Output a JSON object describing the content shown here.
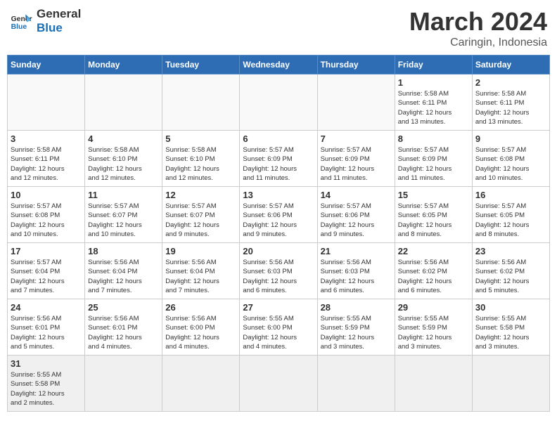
{
  "header": {
    "logo_general": "General",
    "logo_blue": "Blue",
    "title": "March 2024",
    "subtitle": "Caringin, Indonesia"
  },
  "weekdays": [
    "Sunday",
    "Monday",
    "Tuesday",
    "Wednesday",
    "Thursday",
    "Friday",
    "Saturday"
  ],
  "weeks": [
    [
      {
        "day": "",
        "info": ""
      },
      {
        "day": "",
        "info": ""
      },
      {
        "day": "",
        "info": ""
      },
      {
        "day": "",
        "info": ""
      },
      {
        "day": "",
        "info": ""
      },
      {
        "day": "1",
        "info": "Sunrise: 5:58 AM\nSunset: 6:11 PM\nDaylight: 12 hours\nand 13 minutes."
      },
      {
        "day": "2",
        "info": "Sunrise: 5:58 AM\nSunset: 6:11 PM\nDaylight: 12 hours\nand 13 minutes."
      }
    ],
    [
      {
        "day": "3",
        "info": "Sunrise: 5:58 AM\nSunset: 6:11 PM\nDaylight: 12 hours\nand 12 minutes."
      },
      {
        "day": "4",
        "info": "Sunrise: 5:58 AM\nSunset: 6:10 PM\nDaylight: 12 hours\nand 12 minutes."
      },
      {
        "day": "5",
        "info": "Sunrise: 5:58 AM\nSunset: 6:10 PM\nDaylight: 12 hours\nand 12 minutes."
      },
      {
        "day": "6",
        "info": "Sunrise: 5:57 AM\nSunset: 6:09 PM\nDaylight: 12 hours\nand 11 minutes."
      },
      {
        "day": "7",
        "info": "Sunrise: 5:57 AM\nSunset: 6:09 PM\nDaylight: 12 hours\nand 11 minutes."
      },
      {
        "day": "8",
        "info": "Sunrise: 5:57 AM\nSunset: 6:09 PM\nDaylight: 12 hours\nand 11 minutes."
      },
      {
        "day": "9",
        "info": "Sunrise: 5:57 AM\nSunset: 6:08 PM\nDaylight: 12 hours\nand 10 minutes."
      }
    ],
    [
      {
        "day": "10",
        "info": "Sunrise: 5:57 AM\nSunset: 6:08 PM\nDaylight: 12 hours\nand 10 minutes."
      },
      {
        "day": "11",
        "info": "Sunrise: 5:57 AM\nSunset: 6:07 PM\nDaylight: 12 hours\nand 10 minutes."
      },
      {
        "day": "12",
        "info": "Sunrise: 5:57 AM\nSunset: 6:07 PM\nDaylight: 12 hours\nand 9 minutes."
      },
      {
        "day": "13",
        "info": "Sunrise: 5:57 AM\nSunset: 6:06 PM\nDaylight: 12 hours\nand 9 minutes."
      },
      {
        "day": "14",
        "info": "Sunrise: 5:57 AM\nSunset: 6:06 PM\nDaylight: 12 hours\nand 9 minutes."
      },
      {
        "day": "15",
        "info": "Sunrise: 5:57 AM\nSunset: 6:05 PM\nDaylight: 12 hours\nand 8 minutes."
      },
      {
        "day": "16",
        "info": "Sunrise: 5:57 AM\nSunset: 6:05 PM\nDaylight: 12 hours\nand 8 minutes."
      }
    ],
    [
      {
        "day": "17",
        "info": "Sunrise: 5:57 AM\nSunset: 6:04 PM\nDaylight: 12 hours\nand 7 minutes."
      },
      {
        "day": "18",
        "info": "Sunrise: 5:56 AM\nSunset: 6:04 PM\nDaylight: 12 hours\nand 7 minutes."
      },
      {
        "day": "19",
        "info": "Sunrise: 5:56 AM\nSunset: 6:04 PM\nDaylight: 12 hours\nand 7 minutes."
      },
      {
        "day": "20",
        "info": "Sunrise: 5:56 AM\nSunset: 6:03 PM\nDaylight: 12 hours\nand 6 minutes."
      },
      {
        "day": "21",
        "info": "Sunrise: 5:56 AM\nSunset: 6:03 PM\nDaylight: 12 hours\nand 6 minutes."
      },
      {
        "day": "22",
        "info": "Sunrise: 5:56 AM\nSunset: 6:02 PM\nDaylight: 12 hours\nand 6 minutes."
      },
      {
        "day": "23",
        "info": "Sunrise: 5:56 AM\nSunset: 6:02 PM\nDaylight: 12 hours\nand 5 minutes."
      }
    ],
    [
      {
        "day": "24",
        "info": "Sunrise: 5:56 AM\nSunset: 6:01 PM\nDaylight: 12 hours\nand 5 minutes."
      },
      {
        "day": "25",
        "info": "Sunrise: 5:56 AM\nSunset: 6:01 PM\nDaylight: 12 hours\nand 4 minutes."
      },
      {
        "day": "26",
        "info": "Sunrise: 5:56 AM\nSunset: 6:00 PM\nDaylight: 12 hours\nand 4 minutes."
      },
      {
        "day": "27",
        "info": "Sunrise: 5:55 AM\nSunset: 6:00 PM\nDaylight: 12 hours\nand 4 minutes."
      },
      {
        "day": "28",
        "info": "Sunrise: 5:55 AM\nSunset: 5:59 PM\nDaylight: 12 hours\nand 3 minutes."
      },
      {
        "day": "29",
        "info": "Sunrise: 5:55 AM\nSunset: 5:59 PM\nDaylight: 12 hours\nand 3 minutes."
      },
      {
        "day": "30",
        "info": "Sunrise: 5:55 AM\nSunset: 5:58 PM\nDaylight: 12 hours\nand 3 minutes."
      }
    ],
    [
      {
        "day": "31",
        "info": "Sunrise: 5:55 AM\nSunset: 5:58 PM\nDaylight: 12 hours\nand 2 minutes."
      },
      {
        "day": "",
        "info": ""
      },
      {
        "day": "",
        "info": ""
      },
      {
        "day": "",
        "info": ""
      },
      {
        "day": "",
        "info": ""
      },
      {
        "day": "",
        "info": ""
      },
      {
        "day": "",
        "info": ""
      }
    ]
  ]
}
